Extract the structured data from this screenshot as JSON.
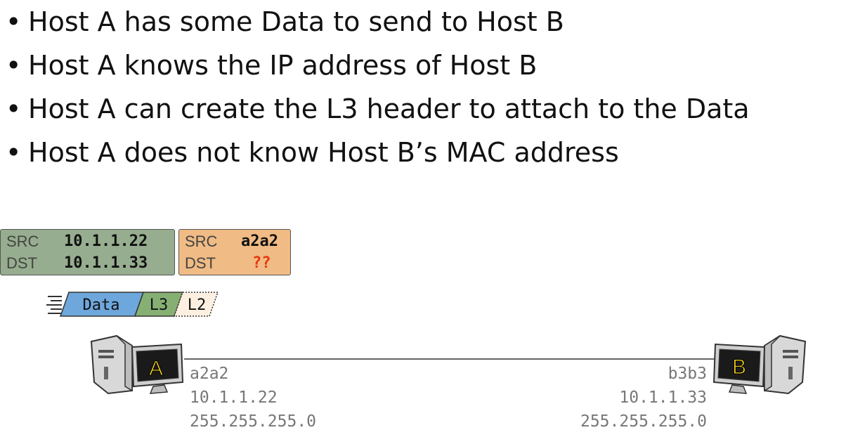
{
  "bullets": [
    "Host A has some Data to send to Host B",
    "Host A knows the IP address of Host B",
    "Host A can create the L3 header to attach to the Data",
    "Host A does not know Host B’s MAC address"
  ],
  "l3_header": {
    "src_label": "SRC",
    "src": "10.1.1.22",
    "dst_label": "DST",
    "dst": "10.1.1.33",
    "color": "#97ad8f"
  },
  "l2_header": {
    "src_label": "SRC",
    "src": "a2a2",
    "dst_label": "DST",
    "dst": "??",
    "color": "#f0bb84",
    "unknown_color": "#e8380d"
  },
  "packet": {
    "data": "Data",
    "l3": "L3",
    "l2": "L2",
    "data_color": "#6ea7dc",
    "l3_color": "#86b073",
    "l2_color": "#fdf0e0"
  },
  "host_a": {
    "label": "A",
    "mac": "a2a2",
    "ip": "10.1.1.22",
    "mask": "255.255.255.0"
  },
  "host_b": {
    "label": "B",
    "mac": "b3b3",
    "ip": "10.1.1.33",
    "mask": "255.255.255.0"
  },
  "icons": {
    "computer": "computer-icon"
  }
}
